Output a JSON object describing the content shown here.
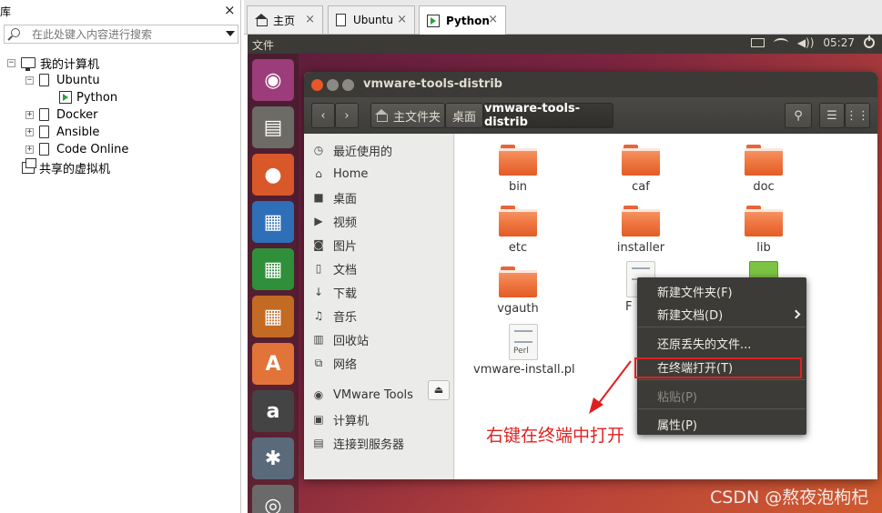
{
  "library": {
    "title": "库",
    "search_placeholder": "在此处键入内容进行搜索",
    "tree": {
      "my_computer": "我的计算机",
      "ubuntu": "Ubuntu",
      "python": "Python",
      "docker": "Docker",
      "ansible": "Ansible",
      "code_online": "Code Online",
      "shared_vms": "共享的虚拟机"
    }
  },
  "tabs": [
    {
      "label": "主页"
    },
    {
      "label": "Ubuntu"
    },
    {
      "label": "Python"
    }
  ],
  "vm": {
    "topbar": {
      "menu_file": "文件",
      "volume_icon": "◀))",
      "time": "05:27"
    },
    "launcher": [
      {
        "name": "ubuntu-dash-icon",
        "glyph": "◉",
        "color": "#9c3c7a"
      },
      {
        "name": "files-icon",
        "glyph": "▤",
        "color": "#6d6b66"
      },
      {
        "name": "firefox-icon",
        "glyph": "●",
        "color": "#d8582a"
      },
      {
        "name": "writer-icon",
        "glyph": "▦",
        "color": "#2f6fb8"
      },
      {
        "name": "calc-icon",
        "glyph": "▦",
        "color": "#2f8f3a"
      },
      {
        "name": "impress-icon",
        "glyph": "▦",
        "color": "#c36a23"
      },
      {
        "name": "software-center-icon",
        "glyph": "A",
        "color": "#e2743a"
      },
      {
        "name": "amazon-icon",
        "glyph": "a",
        "color": "#444444"
      },
      {
        "name": "settings-icon",
        "glyph": "✱",
        "color": "#5a6a7a"
      },
      {
        "name": "dvd-icon",
        "glyph": "◎",
        "color": "#6a6a6a"
      }
    ],
    "nautilus": {
      "title": "vmware-tools-distrib",
      "path": {
        "home": "主文件夹",
        "desktop": "桌面",
        "current": "vmware-tools-distrib"
      },
      "sidebar": {
        "recent": "最近使用的",
        "home": "Home",
        "desktop": "桌面",
        "videos": "视频",
        "pictures": "图片",
        "documents": "文档",
        "downloads": "下载",
        "music": "音乐",
        "trash": "回收站",
        "network": "网络",
        "vmware_tools": "VMware Tools",
        "computer": "计算机",
        "connect_server": "连接到服务器"
      },
      "files": {
        "bin": "bin",
        "caf": "caf",
        "doc": "doc",
        "etc": "etc",
        "installer": "installer",
        "lib": "lib",
        "vgauth": "vgauth",
        "f_partial": "F",
        "install_pl": "vmware-install.pl",
        "perl_label": "Perl"
      },
      "context_menu": {
        "new_folder": "新建文件夹(F)",
        "new_document": "新建文档(D)",
        "restore_missing": "还原丢失的文件...",
        "open_in_terminal": "在终端打开(T)",
        "paste": "粘贴(P)",
        "properties": "属性(P)"
      }
    }
  },
  "annotation": {
    "text": "右键在终端中打开"
  },
  "watermark": "CSDN @熬夜泡枸杞",
  "colors": {
    "annotation_red": "#e02020",
    "ubuntu_orange": "#e35b26"
  }
}
